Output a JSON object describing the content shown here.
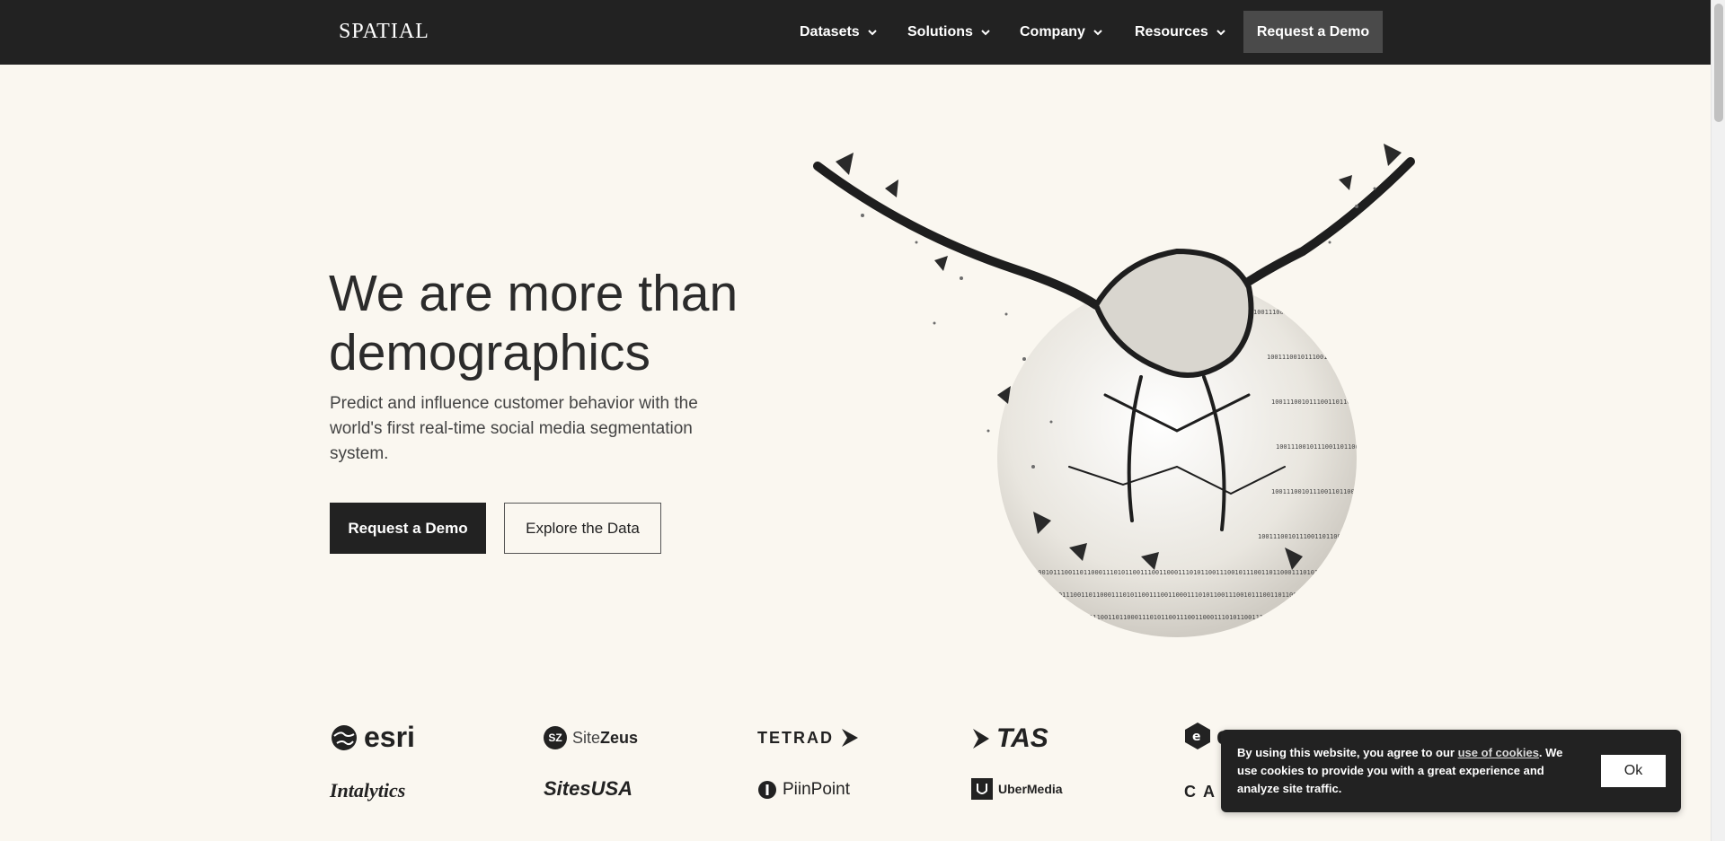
{
  "header": {
    "logo": "SPATIAL",
    "nav": [
      {
        "label": "Datasets"
      },
      {
        "label": "Solutions"
      },
      {
        "label": "Company"
      },
      {
        "label": "Resources"
      }
    ],
    "cta_label": "Request a Demo"
  },
  "hero": {
    "title": "We are more than demographics",
    "subtitle": "Predict and influence customer behavior with the world's first real-time social media segmentation system.",
    "primary_button": "Request a Demo",
    "secondary_button": "Explore the Data",
    "binary_text": "10011100101110011011000111010110011100110001110101100111001011100110110001110101100111001100011101011001110010111001101100011101011001110011000111010110"
  },
  "logos": [
    {
      "name": "esri",
      "text": "esri"
    },
    {
      "name": "sitezeus",
      "mark": "SZ",
      "text_a": "Site",
      "text_b": "Zeus"
    },
    {
      "name": "tetrad",
      "text": "TETRAD"
    },
    {
      "name": "tas",
      "text": "TAS"
    },
    {
      "name": "partial-e",
      "text": "e"
    },
    {
      "name": "intalytics",
      "text": "Intalytics"
    },
    {
      "name": "sitesusa",
      "text": "SitesUSA"
    },
    {
      "name": "piinpoint",
      "text": "PiinPoint"
    },
    {
      "name": "ubermedia",
      "text": "UberMedia"
    },
    {
      "name": "partial-ca",
      "text": "CA"
    }
  ],
  "cookie": {
    "text_before": "By using this website, you agree to our ",
    "link": "use of cookies",
    "text_after": ". We use cookies to provide you with a great experience and analyze site traffic.",
    "ok_label": "Ok"
  },
  "colors": {
    "background": "#faf7f0",
    "header": "#222222",
    "header_button": "#4a4a4a",
    "text": "#2b2b2b"
  }
}
